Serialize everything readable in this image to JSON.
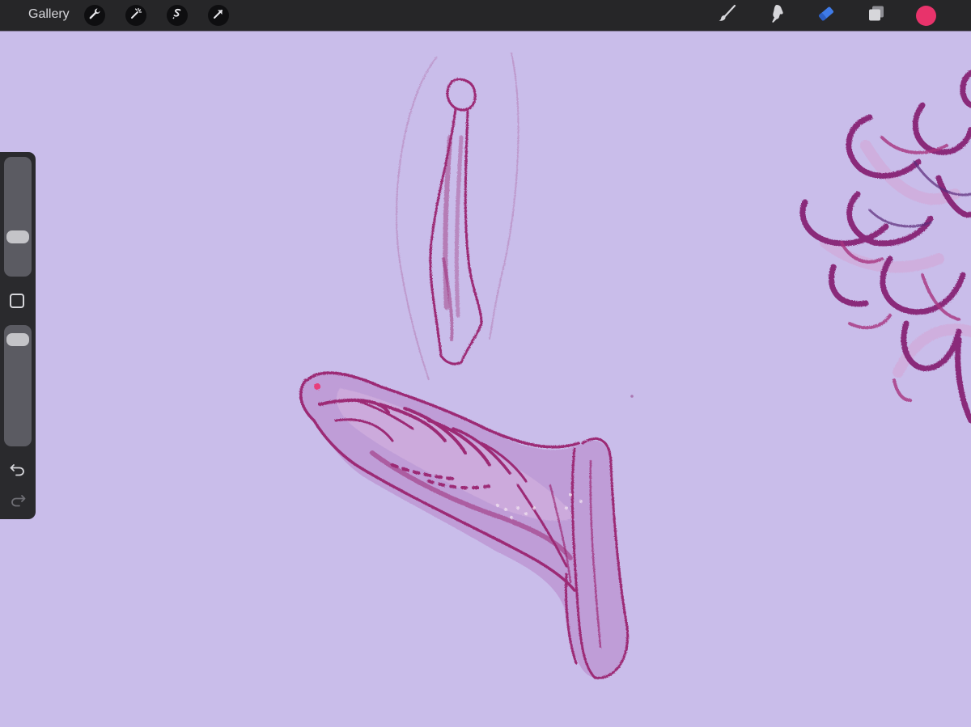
{
  "topbar": {
    "gallery_label": "Gallery",
    "left_icons": [
      "wrench-icon",
      "magic-wand-icon",
      "selection-s-icon",
      "transform-arrow-icon"
    ],
    "right_icons": [
      "brush-icon",
      "smudge-icon",
      "eraser-icon",
      "layers-icon"
    ],
    "eraser_active_color": "#3f7be8",
    "current_color": "#e8336b"
  },
  "sidebar": {
    "brush_size_slider": 0.3,
    "opacity_slider": 0.95,
    "modify_button_icon": "square-icon",
    "undo_icon": "undo-icon",
    "redo_icon": "redo-icon"
  },
  "canvas": {
    "background_color": "#c9bdea",
    "ink_color": "#9c2a74"
  }
}
